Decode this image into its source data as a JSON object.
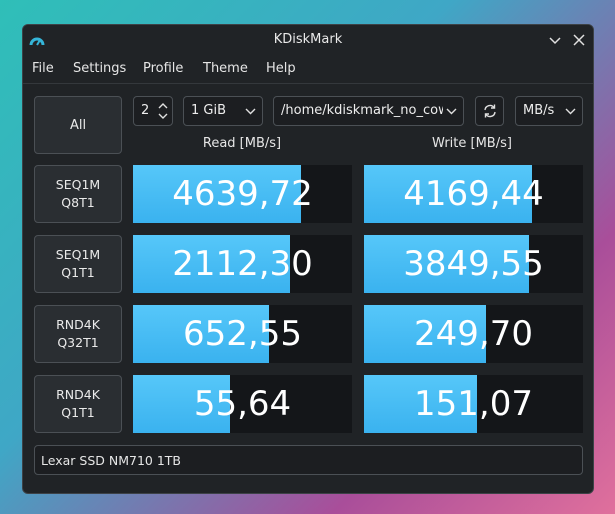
{
  "window": {
    "title": "KDiskMark"
  },
  "menu": [
    "File",
    "Settings",
    "Profile",
    "Theme",
    "Help"
  ],
  "controls": {
    "all_label": "All",
    "loops": "2",
    "size": "1 GiB",
    "path": "/home/kdiskmark_no_cow",
    "unit": "MB/s"
  },
  "columns": {
    "read": "Read [MB/s]",
    "write": "Write [MB/s]"
  },
  "tests": [
    {
      "line1": "SEQ1M",
      "line2": "Q8T1",
      "read": "4639,72",
      "read_fill": 0.765,
      "write": "4169,44",
      "write_fill": 0.765
    },
    {
      "line1": "SEQ1M",
      "line2": "Q1T1",
      "read": "2112,30",
      "read_fill": 0.715,
      "write": "3849,55",
      "write_fill": 0.755
    },
    {
      "line1": "RND4K",
      "line2": "Q32T1",
      "read": "652,55",
      "read_fill": 0.62,
      "write": "249,70",
      "write_fill": 0.555
    },
    {
      "line1": "RND4K",
      "line2": "Q1T1",
      "read": "55,64",
      "read_fill": 0.445,
      "write": "151,07",
      "write_fill": 0.515
    }
  ],
  "device": "Lexar SSD NM710 1TB",
  "colors": {
    "bar": "#3ab2ef",
    "window_bg": "#202326",
    "cell_bg": "#141619"
  }
}
